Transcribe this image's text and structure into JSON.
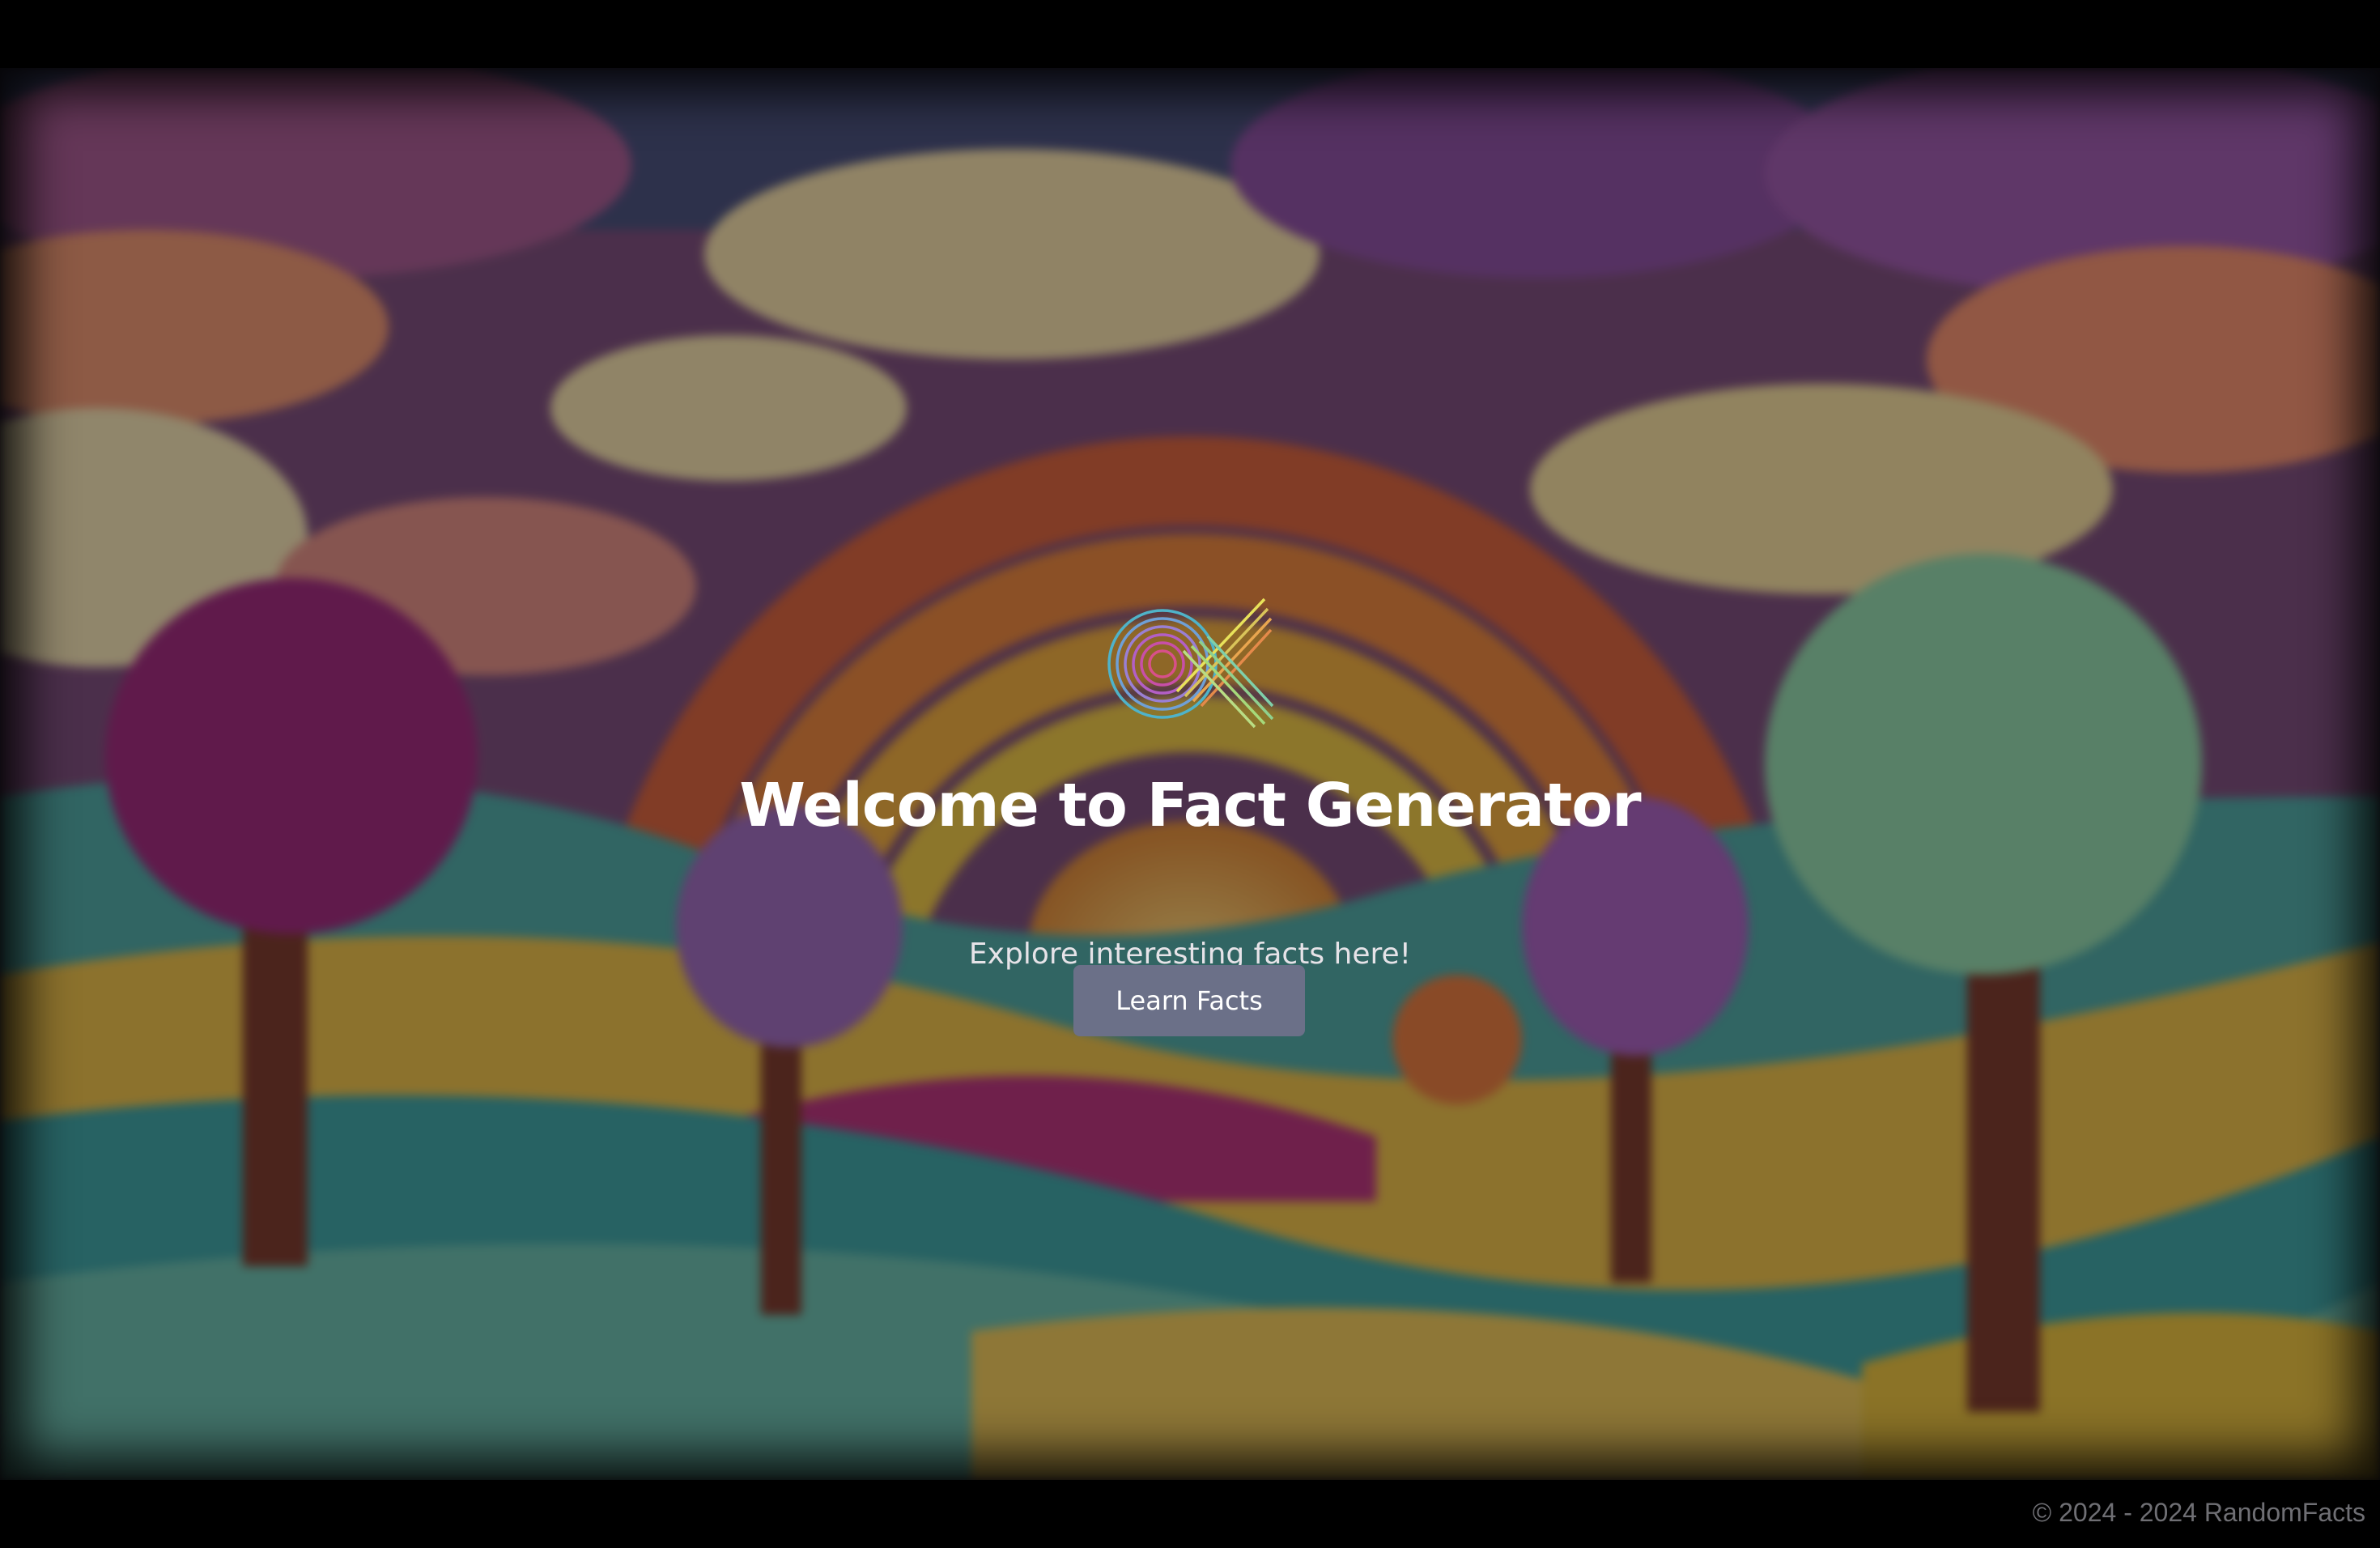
{
  "hero": {
    "title": "Welcome to Fact Generator",
    "subtitle": "Explore interesting facts here!",
    "button_label": "Learn Facts",
    "logo_icon": "rainbow-swirl-logo-icon",
    "background": "papercraft-rainbow-landscape"
  },
  "footer": {
    "copyright": "© 2024 - 2024 RandomFacts"
  },
  "colors": {
    "button": "#6b7088",
    "title": "#ffffff",
    "footer_text": "#6f6f74"
  }
}
